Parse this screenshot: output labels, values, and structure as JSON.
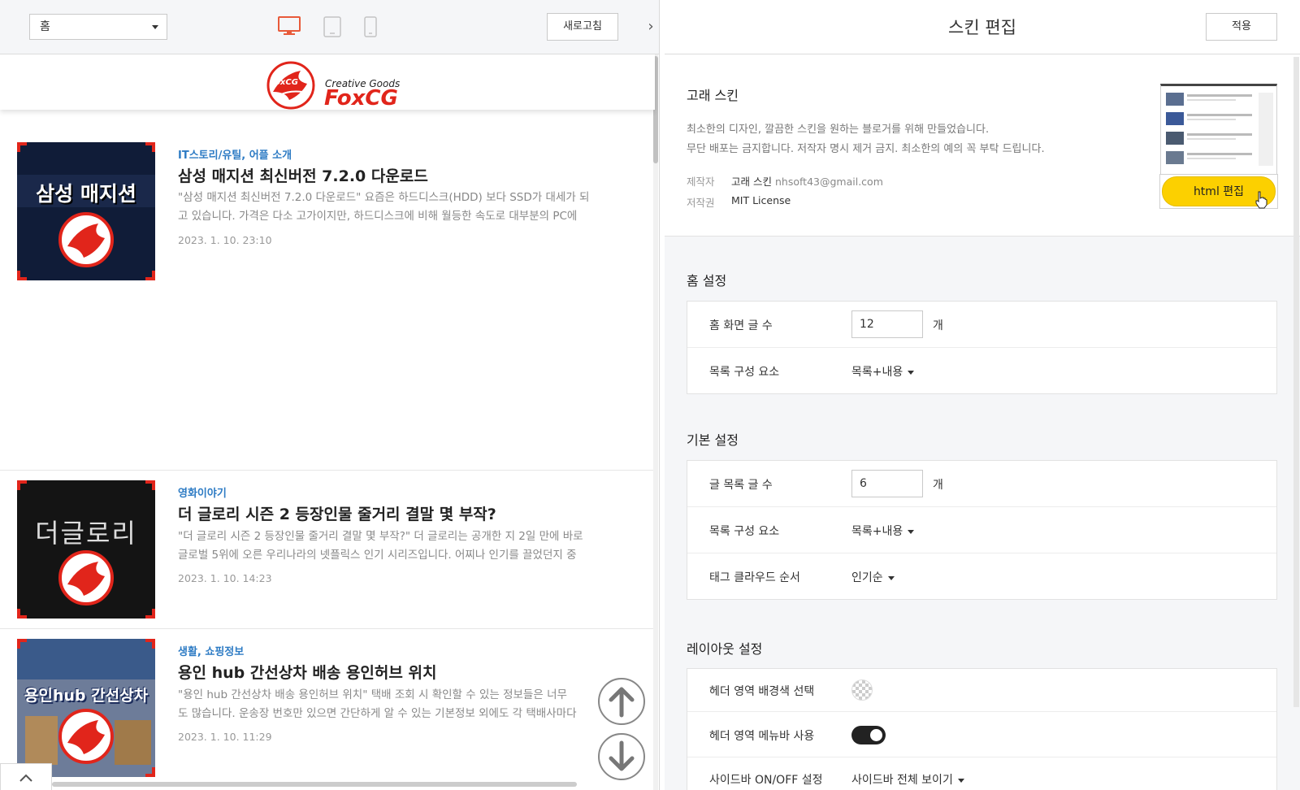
{
  "preview_toolbar": {
    "page_select_value": "홈",
    "refresh_label": "새로고침"
  },
  "blog": {
    "logo_small": "FoxCG",
    "logo_tagline": "Creative Goods",
    "logo_brand": "FoxCG"
  },
  "posts": [
    {
      "thumb_text": "삼성 매지션",
      "category": "IT스토리/유틸, 어플 소개",
      "title": "삼성 매지션 최신버전 7.2.0 다운로드",
      "excerpt_line1": "\"삼성 매지션 최신버전 7.2.0 다운로드\" 요즘은 하드디스크(HDD) 보다 SSD가 대세가 되",
      "excerpt_line2": "고 있습니다. 가격은 다소 고가이지만, 하드디스크에 비해 월등한 속도로 대부분의 PC에",
      "date": "2023. 1. 10. 23:10"
    },
    {
      "thumb_text": "더글로리",
      "category": "영화이야기",
      "title": "더 글로리 시즌 2 등장인물 줄거리 결말 몇 부작?",
      "excerpt_line1": "\"더 글로리 시즌 2 등장인물 줄거리 결말 몇 부작?\" 더 글로리는 공개한 지 2일 만에 바로",
      "excerpt_line2": "글로벌 5위에 오른 우리나라의 넷플릭스 인기 시리즈입니다. 어찌나 인기를 끌었던지 중",
      "date": "2023. 1. 10. 14:23"
    },
    {
      "thumb_text": "용인hub 간선상차",
      "category": "생활, 쇼핑정보",
      "title": "용인 hub 간선상차 배송 용인허브 위치",
      "excerpt_line1": "\"용인 hub 간선상차 배송 용인허브 위치\" 택배 조회 시 확인할 수 있는 정보들은 너무",
      "excerpt_line2": "도 많습니다. 운송장 번호만 있으면 간단하게 알 수 있는 기본정보 외에도 각 택배사마다",
      "date": "2023. 1. 10. 11:29"
    }
  ],
  "editor": {
    "title": "스킨 편집",
    "apply_label": "적용",
    "skin": {
      "name": "고래 스킨",
      "desc_line1": "최소한의 디자인, 깔끔한 스킨을 원하는 블로거를 위해 만들었습니다.",
      "desc_line2": "무단 배포는 금지합니다. 저작자 명시 제거 금지. 최소한의 예의 꼭 부탁 드립니다.",
      "maker_label": "제작자",
      "maker_value": "고래 스킨",
      "maker_email": "nhsoft43@gmail.com",
      "license_label": "저작권",
      "license_value": "MIT License",
      "html_edit_label": "html 편집"
    },
    "home_settings": {
      "title": "홈 설정",
      "rows": [
        {
          "label": "홈 화면 글 수",
          "value": "12",
          "unit": "개"
        },
        {
          "label": "목록 구성 요소",
          "value": "목록+내용"
        }
      ]
    },
    "basic_settings": {
      "title": "기본 설정",
      "rows": [
        {
          "label": "글 목록 글 수",
          "value": "6",
          "unit": "개"
        },
        {
          "label": "목록 구성 요소",
          "value": "목록+내용"
        },
        {
          "label": "태그 클라우드 순서",
          "value": "인기순"
        }
      ]
    },
    "layout_settings": {
      "title": "레이아웃 설정",
      "rows": [
        {
          "label": "헤더 영역 배경색 선택"
        },
        {
          "label": "헤더 영역 메뉴바 사용",
          "toggle_on": true
        },
        {
          "label": "사이드바 ON/OFF 설정",
          "value": "사이드바 전체 보이기"
        }
      ]
    }
  },
  "colors": {
    "accent_blue": "#2d7bc4",
    "html_btn_yellow": "#fcd000",
    "fox_red": "#e1251b",
    "desktop_icon_active": "#e85a3a"
  }
}
